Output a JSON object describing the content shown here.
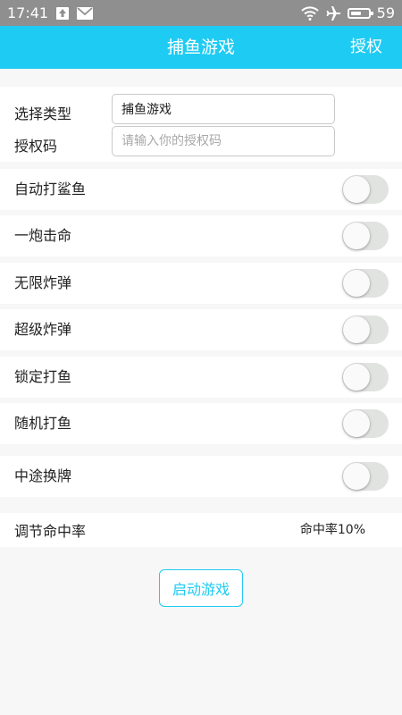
{
  "status_bar": {
    "time": "17:41",
    "battery_level": "59",
    "battery_fraction": 0.59
  },
  "app_bar": {
    "title": "捕鱼游戏",
    "action_label": "授权",
    "color": "#1ecbf3"
  },
  "form": {
    "type_label": "选择类型",
    "type_value": "捕鱼游戏",
    "code_label": "授权码",
    "code_value": "",
    "code_placeholder": "请输入你的授权码"
  },
  "toggles": [
    {
      "label": "自动打鲨鱼",
      "on": false
    },
    {
      "label": "一炮击命",
      "on": false
    },
    {
      "label": "无限炸弹",
      "on": false
    },
    {
      "label": "超级炸弹",
      "on": false
    },
    {
      "label": "锁定打鱼",
      "on": false
    },
    {
      "label": "随机打鱼",
      "on": false
    },
    {
      "label": "中途换牌",
      "on": false
    }
  ],
  "hit_rate": {
    "label": "调节命中率",
    "value_text": "命中率10%"
  },
  "start_button": {
    "label": "启动游戏"
  }
}
